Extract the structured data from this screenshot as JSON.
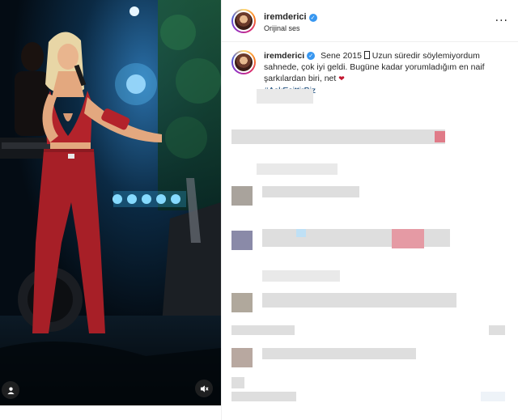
{
  "post": {
    "username": "iremderici",
    "audio_label": "Orijinal ses",
    "caption_text_1": "Sene 2015",
    "caption_text_2": "Uzun süredir söylemiyordum sahnede, çok iyi geldi. Bugüne kadar yorumladığım en naif şarkılardan biri, net",
    "hashtag": "#AşkEşittirBiz"
  },
  "icons": {
    "verified": "verified-badge-icon",
    "more": "more-options-icon",
    "heart": "red-heart-emoji",
    "user_tag": "user-tag-icon",
    "mute": "mute-icon"
  },
  "colors": {
    "accent": "#3897f0",
    "hashtag": "#00376b",
    "heart": "#c2152e",
    "stage_red": "#b3232b",
    "stage_blue": "#3cc4ff"
  }
}
